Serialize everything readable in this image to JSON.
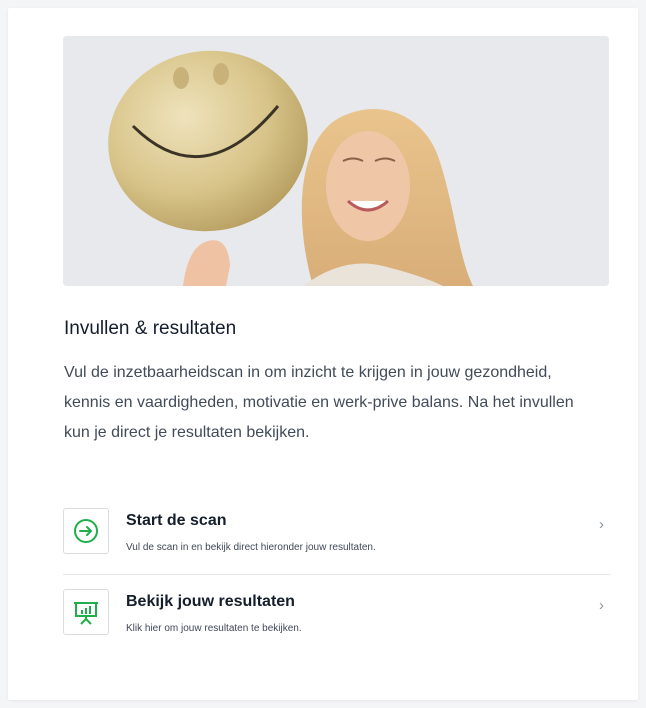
{
  "card": {
    "title": "Invullen & resultaten",
    "description": "Vul de inzetbaarheidscan in om inzicht te krijgen in jouw gezondheid, kennis en vaardigheden, motivatie en werk-prive balans. Na het invullen kun je direct je resultaten bekijken."
  },
  "actions": [
    {
      "title": "Start de scan",
      "subtitle": "Vul de scan in en bekijk direct hieronder jouw resultaten.",
      "icon": "arrow-circle-right-icon",
      "chevron": "›"
    },
    {
      "title": "Bekijk jouw resultaten",
      "subtitle": "Klik hier om jouw resultaten te bekijken.",
      "icon": "presentation-chart-icon",
      "chevron": "›"
    }
  ],
  "colors": {
    "accent": "#1fae4b"
  }
}
